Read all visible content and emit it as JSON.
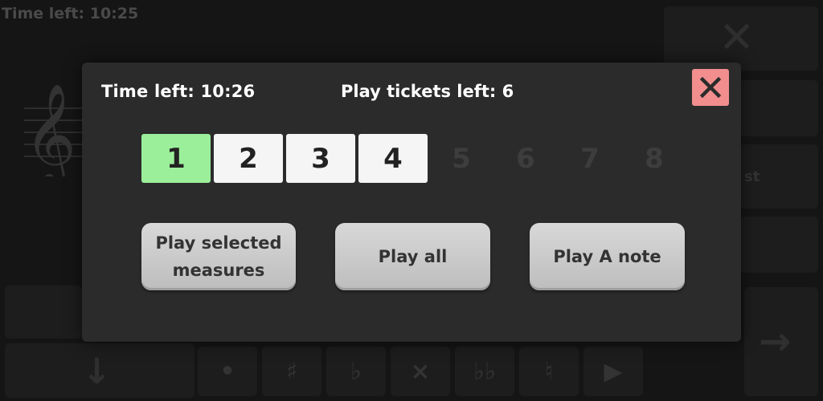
{
  "background": {
    "time_left": "Time left: 10:25",
    "side_label": "st",
    "accidentals": [
      "•",
      "♯",
      "♭",
      "×",
      "♭♭",
      "♮",
      "▶"
    ]
  },
  "modal": {
    "time_left": "Time left: 10:26",
    "tickets": "Play tickets left: 6",
    "measures": [
      "1",
      "2",
      "3",
      "4",
      "5",
      "6",
      "7",
      "8"
    ],
    "selected_measure": "1",
    "enabled_measures": [
      "1",
      "2",
      "3",
      "4"
    ],
    "buttons": {
      "play_selected": "Play selected\nmeasures",
      "play_all": "Play all",
      "play_a_note": "Play A note"
    }
  },
  "colors": {
    "modal_bg": "#2b2b2b",
    "selected": "#9bef9a",
    "close": "#f28e8e"
  }
}
